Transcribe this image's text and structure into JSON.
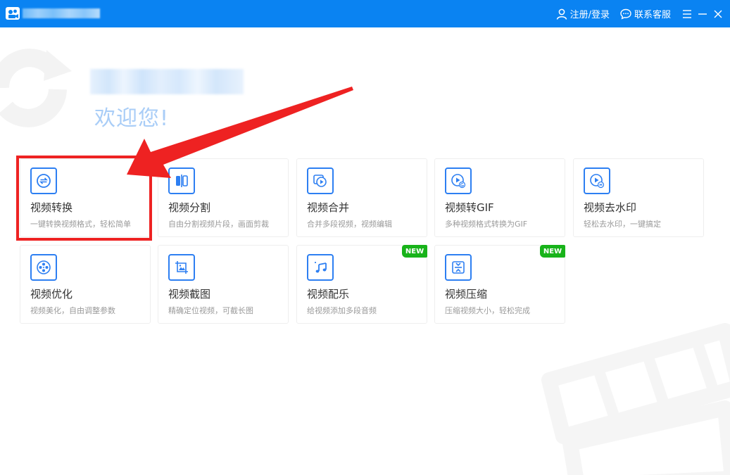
{
  "titlebar": {
    "login_label": "注册/登录",
    "service_label": "联系客服",
    "icons": [
      "user-icon",
      "chat-icon",
      "menu-icon",
      "minimize-icon",
      "close-icon"
    ]
  },
  "welcome": {
    "greeting": "欢迎您!"
  },
  "tools": [
    {
      "title": "视频转换",
      "desc": "一键转换视频格式，轻松简单",
      "icon": "convert-icon",
      "badge": ""
    },
    {
      "title": "视频分割",
      "desc": "自由分割视频片段，画面剪裁",
      "icon": "split-icon",
      "badge": ""
    },
    {
      "title": "视频合并",
      "desc": "合并多段视频，视频编辑",
      "icon": "merge-icon",
      "badge": ""
    },
    {
      "title": "视频转GIF",
      "desc": "多种视频格式转换为GIF",
      "icon": "gif-icon",
      "badge": ""
    },
    {
      "title": "视频去水印",
      "desc": "轻松去水印，一键搞定",
      "icon": "watermark-icon",
      "badge": ""
    },
    {
      "title": "视频优化",
      "desc": "视频美化，自由调整参数",
      "icon": "optimize-icon",
      "badge": ""
    },
    {
      "title": "视频截图",
      "desc": "精确定位视频，可截长图",
      "icon": "screenshot-icon",
      "badge": ""
    },
    {
      "title": "视频配乐",
      "desc": "给视频添加多段音频",
      "icon": "music-icon",
      "badge": "NEW"
    },
    {
      "title": "视频压缩",
      "desc": "压缩视频大小，轻松完成",
      "icon": "compress-icon",
      "badge": "NEW"
    }
  ],
  "colors": {
    "titlebar": "#0a83f2",
    "accent": "#2d7ff2",
    "badge": "#18b31a",
    "annotation": "#ee2222",
    "welcome_text": "#a9cdf7"
  }
}
